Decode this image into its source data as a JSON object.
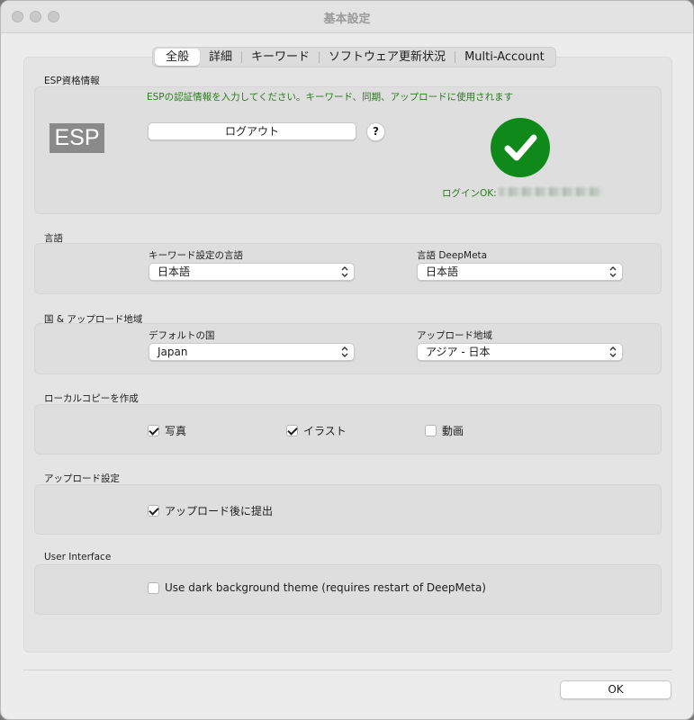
{
  "window": {
    "title": "基本設定"
  },
  "tabs": [
    {
      "label": "全般"
    },
    {
      "label": "詳細"
    },
    {
      "label": "キーワード"
    },
    {
      "label": "ソフトウェア更新状況"
    },
    {
      "label": "Multi-Account"
    }
  ],
  "esp": {
    "section_label": "ESP資格情報",
    "hint": "ESPの認証情報を入力してください。キーワード、同期、アップロードに使用されます",
    "logo_text": "ESP",
    "logout_label": "ログアウト",
    "help_label": "?",
    "status_prefix": "ログインOK:",
    "status_color": "#0f8a1a"
  },
  "language": {
    "section_label": "言語",
    "keyword_lang_label": "キーワード設定の言語",
    "keyword_lang_value": "日本語",
    "deepmeta_lang_label": "言語 DeepMeta",
    "deepmeta_lang_value": "日本語"
  },
  "region": {
    "section_label": "国 & アップロード地域",
    "country_label": "デフォルトの国",
    "country_value": "Japan",
    "upload_region_label": "アップロード地域",
    "upload_region_value": "アジア - 日本"
  },
  "local_copy": {
    "section_label": "ローカルコピーを作成",
    "photo_label": "写真",
    "photo_checked": true,
    "illust_label": "イラスト",
    "illust_checked": true,
    "video_label": "動画",
    "video_checked": false
  },
  "upload": {
    "section_label": "アップロード設定",
    "submit_after_label": "アップロード後に提出",
    "submit_after_checked": true
  },
  "ui": {
    "section_label": "User Interface",
    "dark_theme_label": "Use dark background theme (requires restart of DeepMeta)",
    "dark_theme_checked": false
  },
  "footer": {
    "ok_label": "OK"
  }
}
